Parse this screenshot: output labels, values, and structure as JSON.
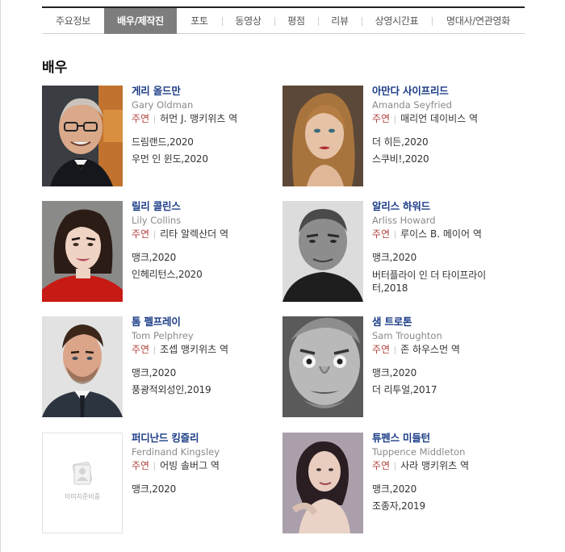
{
  "tabs": [
    {
      "label": "주요정보",
      "active": false
    },
    {
      "label": "배우/제작진",
      "active": true
    },
    {
      "label": "포토",
      "active": false
    },
    {
      "label": "동영상",
      "active": false
    },
    {
      "label": "평점",
      "active": false
    },
    {
      "label": "리뷰",
      "active": false
    },
    {
      "label": "상영시간표",
      "active": false
    },
    {
      "label": "명대사/연관영화",
      "active": false
    }
  ],
  "section": {
    "title": "배우"
  },
  "actors": [
    {
      "name_ko": "게리 올드만",
      "name_en": "Gary Oldman",
      "role_type": "주연",
      "role": "허먼 J. 맹키위츠 역",
      "films": [
        "드림랜드,2020",
        "우먼 인 윈도,2020"
      ]
    },
    {
      "name_ko": "아만다 사이프리드",
      "name_en": "Amanda Seyfried",
      "role_type": "주연",
      "role": "매리언 데이비스 역",
      "films": [
        "더 히든,2020",
        "스쿠비!,2020"
      ]
    },
    {
      "name_ko": "릴리 콜린스",
      "name_en": "Lily Collins",
      "role_type": "주연",
      "role": "리타 알렉산더 역",
      "films": [
        "맹크,2020",
        "인헤리턴스,2020"
      ]
    },
    {
      "name_ko": "알리스 하워드",
      "name_en": "Arliss Howard",
      "role_type": "주연",
      "role": "루이스 B. 메이어 역",
      "films": [
        "맹크,2020",
        "버터플라이 인 더 타이프라이터,2018"
      ]
    },
    {
      "name_ko": "톰 펠프레이",
      "name_en": "Tom Pelphrey",
      "role_type": "주연",
      "role": "조셉 맹키위츠 역",
      "films": [
        "맹크,2020",
        "풍광적외성인,2019"
      ]
    },
    {
      "name_ko": "샘 트로톤",
      "name_en": "Sam Troughton",
      "role_type": "주연",
      "role": "존 하우스먼 역",
      "films": [
        "맹크,2020",
        "더 리투얼,2017"
      ]
    },
    {
      "name_ko": "퍼디난드 킹즐리",
      "name_en": "Ferdinand Kingsley",
      "role_type": "주연",
      "role": "어빙 솔버그 역",
      "films": [
        "맹크,2020"
      ],
      "no_image": true,
      "no_image_text": "이미지준비중"
    },
    {
      "name_ko": "튜펜스 미들턴",
      "name_en": "Tuppence Middleton",
      "role_type": "주연",
      "role": "사라 맹키위츠 역",
      "films": [
        "맹크,2020",
        "조종자,2019"
      ]
    }
  ],
  "colors": {
    "name_link": "#1b3c86",
    "lead": "#b0413e",
    "active_tab": "#7d7d7d"
  }
}
